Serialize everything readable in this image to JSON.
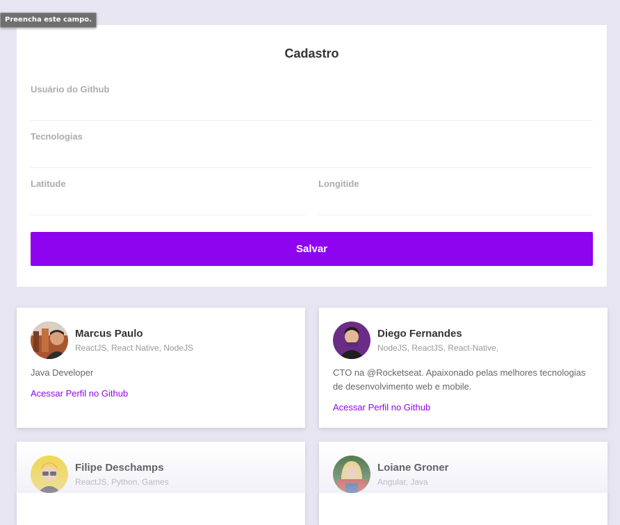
{
  "tooltip": {
    "text": "Preencha este campo."
  },
  "form": {
    "title": "Cadastro",
    "fields": {
      "github_user": {
        "label": "Usuário do Github",
        "value": ""
      },
      "techs": {
        "label": "Tecnologias",
        "value": ""
      },
      "latitude": {
        "label": "Latitude",
        "value": ""
      },
      "longitude": {
        "label": "Longitide",
        "value": ""
      }
    },
    "submit_label": "Salvar"
  },
  "devs": [
    {
      "name": "Marcus Paulo",
      "techs": "ReactJS, React Native, NodeJS",
      "bio": "Java Developer",
      "link_label": "Acessar Perfil no Github"
    },
    {
      "name": "Diego Fernandes",
      "techs": "NodeJS, ReactJS, React-Native,",
      "bio": "CTO na @Rocketseat. Apaixonado pelas melhores tecnologias de desenvolvimento web e mobile.",
      "link_label": "Acessar Perfil no Github"
    },
    {
      "name": "Filipe Deschamps",
      "techs": "ReactJS, Python, Games",
      "bio": "",
      "link_label": ""
    },
    {
      "name": "Loiane Groner",
      "techs": "Angular, Java",
      "bio": "",
      "link_label": ""
    }
  ],
  "colors": {
    "background": "#e7e5f1",
    "accent": "#8e04ef",
    "label": "#acacac"
  }
}
